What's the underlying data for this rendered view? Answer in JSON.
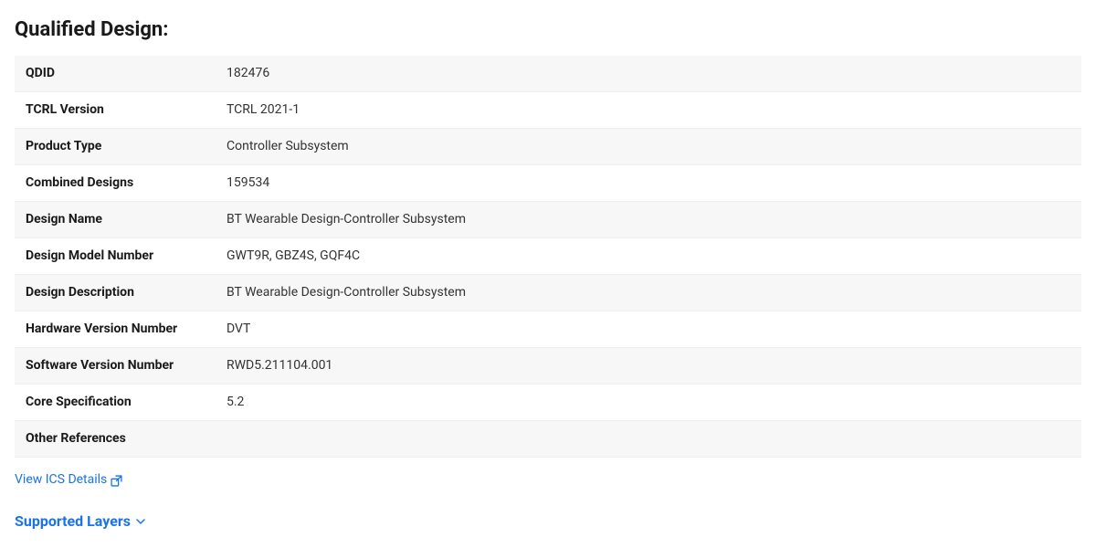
{
  "page": {
    "title": "Qualified Design:"
  },
  "table": {
    "rows": [
      {
        "label": "QDID",
        "value": "182476"
      },
      {
        "label": "TCRL Version",
        "value": "TCRL 2021-1"
      },
      {
        "label": "Product Type",
        "value": "Controller Subsystem"
      },
      {
        "label": "Combined Designs",
        "value": "159534"
      },
      {
        "label": "Design Name",
        "value": "BT Wearable Design-Controller Subsystem"
      },
      {
        "label": "Design Model Number",
        "value": "GWT9R, GBZ4S, GQF4C"
      },
      {
        "label": "Design Description",
        "value": "BT Wearable Design-Controller Subsystem"
      },
      {
        "label": "Hardware Version Number",
        "value": "DVT"
      },
      {
        "label": "Software Version Number",
        "value": "RWD5.211104.001"
      },
      {
        "label": "Core Specification",
        "value": "5.2"
      },
      {
        "label": "Other References",
        "value": ""
      }
    ]
  },
  "links": {
    "view_ics": "View ICS Details"
  },
  "supported_layers": {
    "label": "Supported Layers"
  },
  "icons": {
    "external_link": "↗",
    "chevron_down": "▼"
  }
}
